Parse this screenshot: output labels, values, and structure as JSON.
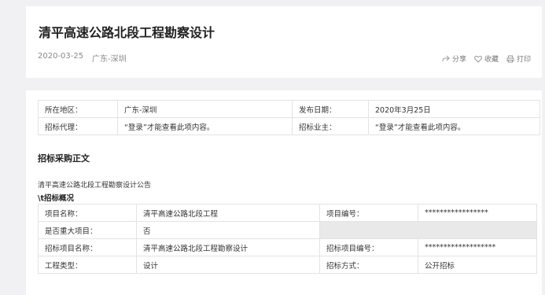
{
  "header": {
    "title": "清平高速公路北段工程勘察设计",
    "date": "2020-03-25",
    "region": "广东-深圳",
    "actions": {
      "share_label": "分享",
      "favorite_label": "收藏",
      "print_label": "打印"
    }
  },
  "info": {
    "region_label": "所在地区：",
    "region_value": "广东-深圳",
    "publish_label": "发布日期：",
    "publish_value": "2020年3月25日",
    "agent_label": "招标代理：",
    "agent_value": "“登录”才能查看此项内容。",
    "owner_label": "招标业主：",
    "owner_value": "“登录”才能查看此项内容。"
  },
  "content": {
    "section_heading": "招标采购正文",
    "notice_title": "清平高速公路北段工程勘察设计公告",
    "overview_heading": "\\t招标概况"
  },
  "details": {
    "project_name_label": "项目名称：",
    "project_name_value": "清平高速公路北段工程",
    "project_no_label": "项目编号：",
    "project_no_value": "*****************",
    "major_label": "是否重大项目：",
    "major_value": "否",
    "bid_item_label": "招标项目名称：",
    "bid_item_value": "清平高速公路北段工程勘察设计",
    "bid_item_no_label": "招标项目编号：",
    "bid_item_no_value": "*******************",
    "type_label": "工程类型：",
    "type_value": "设计",
    "method_label": "招标方式：",
    "method_value": "公开招标"
  }
}
